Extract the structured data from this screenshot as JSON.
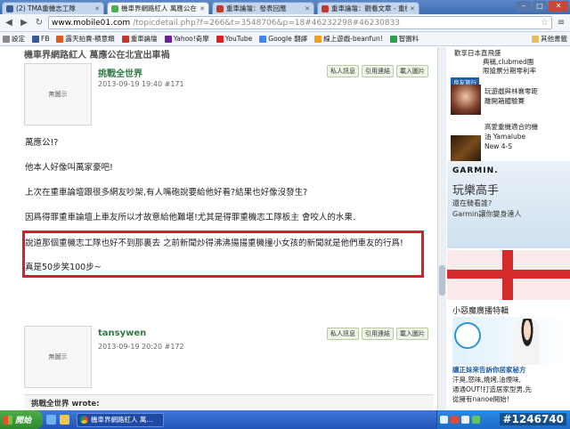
{
  "browser": {
    "tabs": [
      {
        "title": "(2) TMA重機志工隊",
        "icon": "facebook-icon",
        "active": false
      },
      {
        "title": "機車界網路紅人 萬應公在",
        "icon": "mobile01-icon",
        "active": true
      },
      {
        "title": "重車論壇：發表回應",
        "icon": "forum-icon",
        "active": false
      },
      {
        "title": "重車論壇：觀看文章 - 重機",
        "icon": "forum-icon",
        "active": false
      }
    ],
    "url_host": "www.mobile01.com",
    "url_path": "/topicdetail.php?f=266&t=3548706&p=18#46232298#46230833",
    "bookmarks": [
      "設定",
      "FB",
      "露天拍賣-積意類",
      "重車論壇",
      "Yahoo!奇摩",
      "YouTube",
      "Google 翻譯",
      "線上遊戲-beanfun!",
      "智園料"
    ],
    "other_bookmarks": "其他書籤"
  },
  "page": {
    "heading": "機車界網路紅人 萬應公在北宜出車禍",
    "avatar_placeholder": "無圖示",
    "post1": {
      "user": "挑戰全世界",
      "meta": "2013-09-19 19:40 #171",
      "actions": [
        "私人訊息",
        "引用連結",
        "載入圖片"
      ],
      "lines": [
        "萬應公!?",
        "他本人好像叫萬家豪吧!",
        "上次在重車論壇跟很多網友吵架,有人嘴砲說要給他好看?結果也好像沒發生?",
        "因爲得罪重車論壇上車友所以才故意給他難堪!尤其是得罪重機志工隊板主 會咬人的水果."
      ],
      "highlight_lines": [
        "說道那個重機志工隊也好不到那裏去 之前新聞炒得沸沸揚揚重機撞小女孩的新聞就是他們車友的行爲!",
        "真是50步笑100步~"
      ]
    },
    "post2": {
      "user": "tansywen",
      "meta": "2013-09-19 20:20 #172",
      "actions": [
        "私人訊息",
        "引用連結",
        "載入圖片"
      ]
    },
    "quote_label": "挑戰全世界 wrote:"
  },
  "sidebar": {
    "ad_logo": "良友旅行",
    "ad1_lines": [
      "歡享日本直飛盛",
      "典稱,clubmed團",
      "限搶票分期零利率"
    ],
    "ad2_lines": [
      "玩遊戲與林襄零距",
      "離開箱體驗賽"
    ],
    "ad3_lines": [
      "高愛重機適合的機",
      "油 Yamalube",
      "New 4-S"
    ],
    "garmin": {
      "logo": "GARMIN.",
      "title": "玩樂高手",
      "sub1": "還在騎看誰?",
      "sub2": "Garmin讓你變身達人"
    },
    "heading": "小惡魔廣播特輯",
    "cleaner_title": "讓正妹來告訴你居家秘方",
    "cleaner_lines": [
      "汗臭,怒味,燒烤,油煙味,",
      "通通OUT!打造居家型男,先",
      "從擁有nanoe開始!"
    ]
  },
  "taskbar": {
    "start_label": "開始",
    "task_item": "機車界網路紅人 萬...",
    "clock": "#1246740"
  }
}
